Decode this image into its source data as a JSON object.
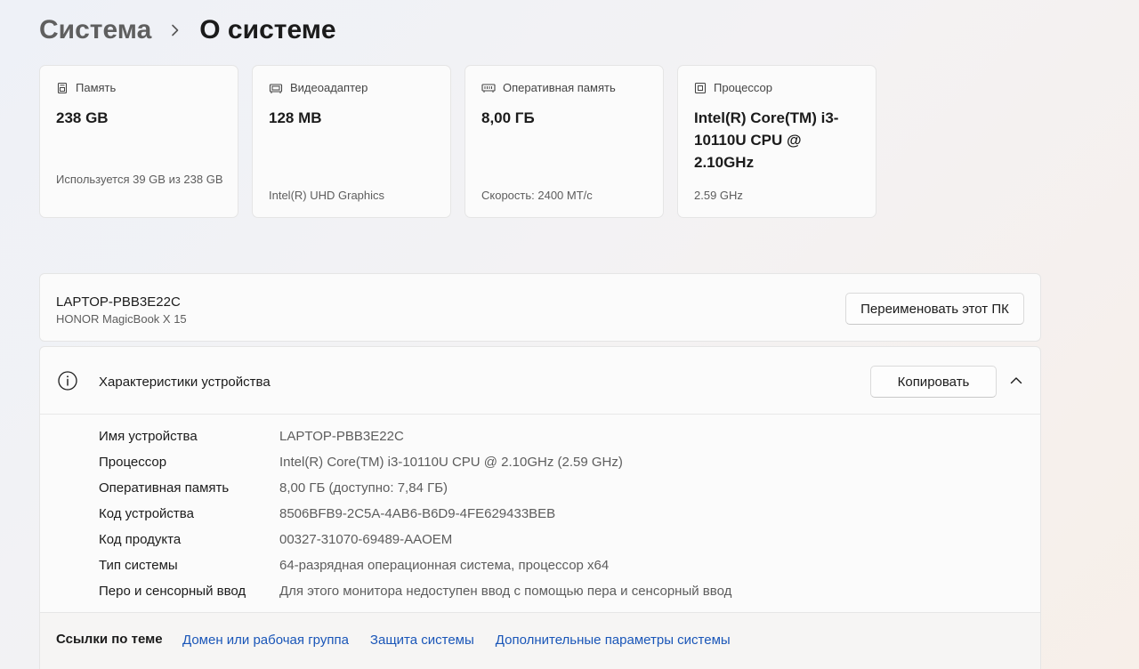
{
  "breadcrumb": {
    "parent": "Система",
    "current": "О системе"
  },
  "cards": [
    {
      "icon": "storage-icon",
      "title": "Память",
      "value": "238 GB",
      "sub": "Используется 39 GB из 238 GB"
    },
    {
      "icon": "gpu-icon",
      "title": "Видеоадаптер",
      "value": "128 MB",
      "sub": "Intel(R) UHD Graphics"
    },
    {
      "icon": "ram-icon",
      "title": "Оперативная память",
      "value": "8,00 ГБ",
      "sub": "Скорость: 2400 МТ/с"
    },
    {
      "icon": "cpu-icon",
      "title": "Процессор",
      "value": "Intel(R) Core(TM) i3-10110U CPU @ 2.10GHz",
      "sub": "2.59 GHz"
    }
  ],
  "pc": {
    "name": "LAPTOP-PBB3E22C",
    "model": "HONOR MagicBook X 15",
    "rename_label": "Переименовать этот ПК"
  },
  "specs": {
    "title": "Характеристики устройства",
    "copy_label": "Копировать",
    "rows": [
      {
        "label": "Имя устройства",
        "value": "LAPTOP-PBB3E22C"
      },
      {
        "label": "Процессор",
        "value": "Intel(R) Core(TM) i3-10110U CPU @ 2.10GHz (2.59 GHz)"
      },
      {
        "label": "Оперативная память",
        "value": "8,00 ГБ (доступно: 7,84 ГБ)"
      },
      {
        "label": "Код устройства",
        "value": "8506BFB9-2C5A-4AB6-B6D9-4FE629433BEB"
      },
      {
        "label": "Код продукта",
        "value": "00327-31070-69489-AAOEM"
      },
      {
        "label": "Тип системы",
        "value": "64-разрядная операционная система, процессор x64"
      },
      {
        "label": "Перо и сенсорный ввод",
        "value": "Для этого монитора недоступен ввод с помощью пера и сенсорный ввод"
      }
    ]
  },
  "related": {
    "title": "Ссылки по теме",
    "links": [
      "Домен или рабочая группа",
      "Защита системы",
      "Дополнительные параметры системы"
    ]
  }
}
